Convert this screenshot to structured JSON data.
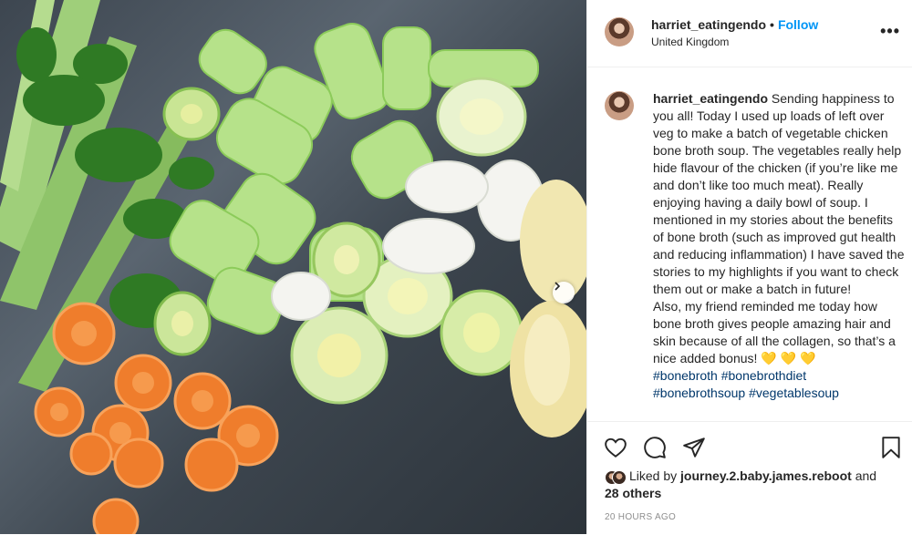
{
  "post": {
    "username": "harriet_eatingendo",
    "separator": "•",
    "follow_label": "Follow",
    "location": "United Kingdom",
    "more_label": "•••"
  },
  "caption": {
    "username": "harriet_eatingendo",
    "text": " Sending happiness to you all! Today I used up loads of left over veg to make a batch of vegetable chicken bone broth soup. The vegetables really help hide flavour of the chicken (if you’re like me and don’t like too much meat). Really enjoying having a daily bowl of soup. I mentioned in my stories about the benefits of bone broth (such as improved gut health and reducing inflammation) I have saved the stories to my highlights if you want to check them out or make a batch in future!\nAlso, my friend reminded me today how bone broth gives people amazing hair and skin because of all the collagen, so that’s a nice added bonus! 💛 💛 💛\n",
    "hashtags_line1": "#bonebroth #bonebrothdiet",
    "hashtags_line2": "#bonebrothsoup #vegetablesoup"
  },
  "likes": {
    "prefix": "Liked by ",
    "user": "journey.2.baby.james.reboot",
    "and": " and",
    "others": "28 others"
  },
  "timestamp": "20 HOURS AGO",
  "icons": {
    "like": "heart-icon",
    "comment": "comment-icon",
    "share": "paper-plane-icon",
    "save": "bookmark-icon",
    "next": "chevron-right-icon",
    "more": "ellipsis-icon"
  },
  "colors": {
    "follow": "#0095f6",
    "hashtag": "#00376b",
    "timestamp": "#8e8e8e",
    "text": "#262626"
  }
}
